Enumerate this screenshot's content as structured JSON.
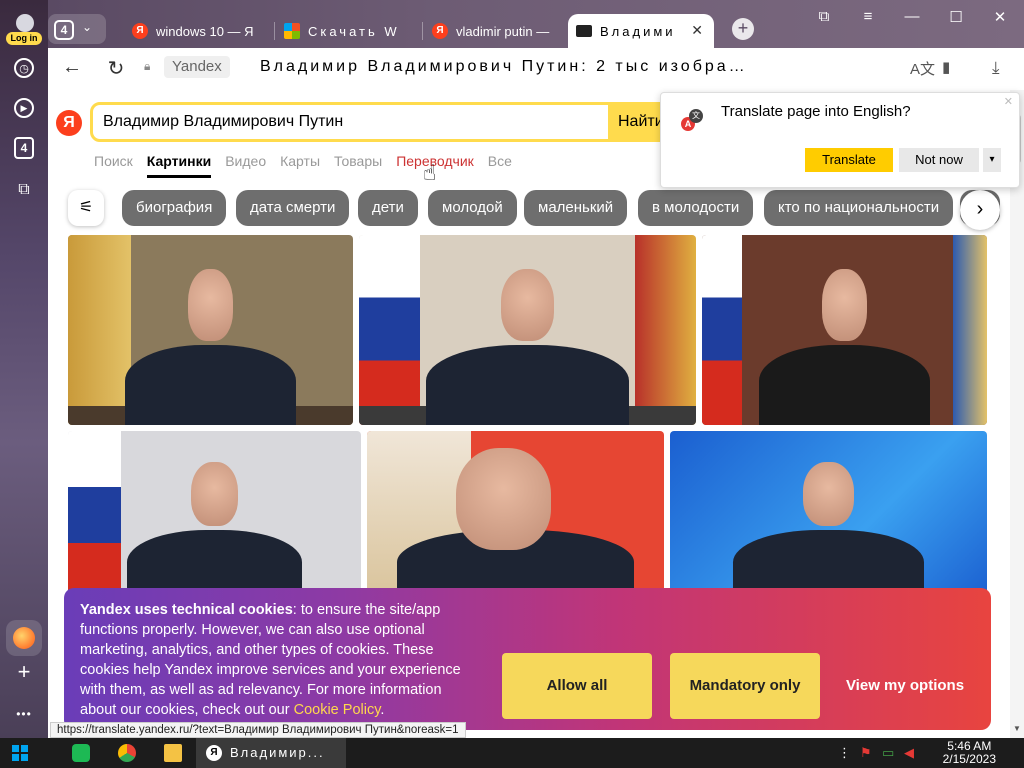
{
  "sidebar": {
    "login_label": "Log in",
    "tab_count": "4",
    "items": [
      {
        "icon": "clock-icon"
      },
      {
        "icon": "play-icon"
      },
      {
        "icon": "screenshot-icon"
      }
    ],
    "more": "•••",
    "add": "+"
  },
  "tabs": {
    "counter": "4",
    "items": [
      {
        "label": "windows 10 — Я",
        "favicon": "yandex"
      },
      {
        "label": "Скачать W",
        "favicon": "microsoft"
      },
      {
        "label": "vladimir putin —",
        "favicon": "yandex"
      },
      {
        "label": "Владими",
        "favicon": "images"
      }
    ],
    "new_tab": "+"
  },
  "address": {
    "host": "Yandex",
    "title": "Владимир Владимирович Путин: 2 тыс изобра…"
  },
  "search": {
    "value": "Владимир Владимирович Путин",
    "button": "Найти",
    "logo": "Я"
  },
  "services": [
    "Поиск",
    "Картинки",
    "Видео",
    "Карты",
    "Товары",
    "Переводчик",
    "Все"
  ],
  "chips": [
    "биография",
    "дата смерти",
    "дети",
    "молодой",
    "маленький",
    "в молодости",
    "кто по национальности"
  ],
  "translate": {
    "title": "Translate page into English?",
    "translate_btn": "Translate",
    "not_now_btn": "Not now"
  },
  "cookie": {
    "bold": "Yandex uses technical cookies",
    "text": ": to ensure the site/app functions properly. However, we can also use optional marketing, analytics, and other types of cookies. These cookies help Yandex improve services and your experience with them, as well as ad relevancy. For more information about our cookies, check out our ",
    "link": "Cookie Policy",
    "end": ".",
    "allow_all": "Allow all",
    "mandatory": "Mandatory only",
    "options": "View my options"
  },
  "status_url": "https://translate.yandex.ru/?text=Владимир Владимирович Путин&noreask=1",
  "taskbar": {
    "task_label": "Владимир...",
    "time": "5:46 AM",
    "date": "2/15/2023"
  },
  "colors": {
    "accent_yellow": "#ffdb4d",
    "yandex_red": "#fc3f1d",
    "chip_gray": "#6e6e6e"
  }
}
